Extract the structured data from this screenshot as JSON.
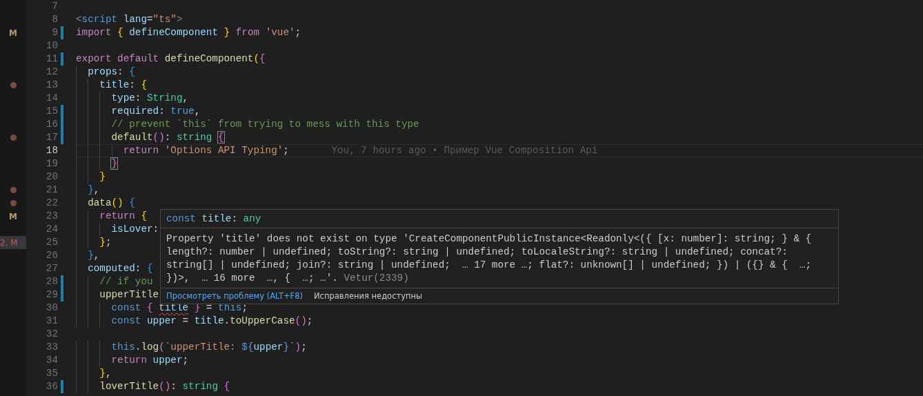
{
  "lines": [
    {
      "number": "7",
      "changed": false,
      "current": false
    },
    {
      "number": "8",
      "changed": false,
      "current": false,
      "tokens": [
        {
          "text": "<",
          "kind": "tagp"
        },
        {
          "text": "script",
          "kind": "tag"
        },
        {
          "text": " lang",
          "kind": "attr"
        },
        {
          "text": "=",
          "kind": "punct"
        },
        {
          "text": "\"ts\"",
          "kind": "str"
        },
        {
          "text": ">",
          "kind": "tagp"
        }
      ]
    },
    {
      "number": "9",
      "changed": true,
      "current": false,
      "mark": {
        "kind": "letter",
        "text": "M",
        "selected": false
      },
      "tokens": [
        {
          "text": "import",
          "kind": "kw"
        },
        {
          "text": " {",
          "kind": "b1"
        },
        {
          "text": " defineComponent",
          "kind": "var"
        },
        {
          "text": " }",
          "kind": "b1"
        },
        {
          "text": " from",
          "kind": "kw"
        },
        {
          "text": " 'vue'",
          "kind": "str"
        },
        {
          "text": ";",
          "kind": "punct"
        }
      ]
    },
    {
      "number": "10",
      "changed": false,
      "current": false
    },
    {
      "number": "11",
      "changed": true,
      "current": false,
      "tokens": [
        {
          "text": "export",
          "kind": "kw"
        },
        {
          "text": " default",
          "kind": "kw"
        },
        {
          "text": " defineComponent",
          "kind": "fn"
        },
        {
          "text": "(",
          "kind": "b1"
        },
        {
          "text": "{",
          "kind": "b2"
        }
      ]
    },
    {
      "number": "12",
      "changed": false,
      "current": false,
      "tokens": [
        {
          "text": "  props",
          "kind": "var"
        },
        {
          "text": ":",
          "kind": "punct"
        },
        {
          "text": " {",
          "kind": "b3"
        }
      ]
    },
    {
      "number": "13",
      "changed": false,
      "current": false,
      "mark": {
        "kind": "dot",
        "selected": false
      },
      "tokens": [
        {
          "text": "    title",
          "kind": "var"
        },
        {
          "text": ":",
          "kind": "punct"
        },
        {
          "text": " {",
          "kind": "b1"
        }
      ]
    },
    {
      "number": "14",
      "changed": false,
      "current": false,
      "tokens": [
        {
          "text": "      type",
          "kind": "var"
        },
        {
          "text": ":",
          "kind": "punct"
        },
        {
          "text": " String",
          "kind": "type"
        },
        {
          "text": ",",
          "kind": "punct"
        }
      ]
    },
    {
      "number": "15",
      "changed": true,
      "current": false,
      "tokens": [
        {
          "text": "      required",
          "kind": "var"
        },
        {
          "text": ":",
          "kind": "punct"
        },
        {
          "text": " true",
          "kind": "const"
        },
        {
          "text": ",",
          "kind": "punct"
        }
      ]
    },
    {
      "number": "16",
      "changed": true,
      "current": false,
      "tokens": [
        {
          "text": "      // prevent `this` from trying to mess with this type",
          "kind": "comment"
        }
      ]
    },
    {
      "number": "17",
      "changed": true,
      "current": false,
      "mark": {
        "kind": "dot",
        "selected": false
      },
      "tokens": [
        {
          "text": "      default",
          "kind": "fn"
        },
        {
          "text": "(",
          "kind": "b2"
        },
        {
          "text": ")",
          "kind": "b2"
        },
        {
          "text": ":",
          "kind": "punct"
        },
        {
          "text": " string",
          "kind": "type"
        },
        {
          "text": " {",
          "kind": "b2m"
        }
      ]
    },
    {
      "number": "18",
      "changed": false,
      "current": true,
      "blame": "You, 7 hours ago • Пример Vue Composition Api",
      "tokens": [
        {
          "text": "        return",
          "kind": "kw"
        },
        {
          "text": " 'Options API Typing'",
          "kind": "str"
        },
        {
          "text": ";",
          "kind": "punct"
        }
      ]
    },
    {
      "number": "19",
      "changed": false,
      "current": false,
      "tokens": [
        {
          "text": "      }",
          "kind": "b2m"
        }
      ]
    },
    {
      "number": "20",
      "changed": false,
      "current": false,
      "tokens": [
        {
          "text": "    }",
          "kind": "b1"
        }
      ]
    },
    {
      "number": "21",
      "changed": false,
      "current": false,
      "mark": {
        "kind": "dot",
        "selected": false
      },
      "tokens": [
        {
          "text": "  }",
          "kind": "b3"
        },
        {
          "text": ",",
          "kind": "punct"
        }
      ]
    },
    {
      "number": "22",
      "changed": false,
      "current": false,
      "mark": {
        "kind": "dot",
        "selected": false
      },
      "tokens": [
        {
          "text": "  data",
          "kind": "fn"
        },
        {
          "text": "(",
          "kind": "b1"
        },
        {
          "text": ")",
          "kind": "b1"
        },
        {
          "text": " {",
          "kind": "b3"
        }
      ]
    },
    {
      "number": "23",
      "changed": false,
      "current": false,
      "mark": {
        "kind": "letter",
        "text": "M",
        "selected": false
      },
      "tokens": [
        {
          "text": "    return",
          "kind": "kw"
        },
        {
          "text": " {",
          "kind": "b1"
        }
      ]
    },
    {
      "number": "24",
      "changed": false,
      "current": false,
      "tokens": [
        {
          "text": "      isLover",
          "kind": "var"
        },
        {
          "text": ":",
          "kind": "punct"
        }
      ]
    },
    {
      "number": "25",
      "changed": false,
      "current": false,
      "mark": {
        "kind": "letter",
        "text": "2, M",
        "selected": true
      },
      "tokens": [
        {
          "text": "    }",
          "kind": "b1"
        },
        {
          "text": ";",
          "kind": "punct"
        }
      ]
    },
    {
      "number": "26",
      "changed": false,
      "current": false,
      "tokens": [
        {
          "text": "  }",
          "kind": "b3"
        },
        {
          "text": ",",
          "kind": "punct"
        }
      ]
    },
    {
      "number": "27",
      "changed": false,
      "current": false,
      "tokens": [
        {
          "text": "  computed",
          "kind": "var"
        },
        {
          "text": ":",
          "kind": "punct"
        },
        {
          "text": " {",
          "kind": "b3"
        }
      ]
    },
    {
      "number": "28",
      "changed": true,
      "current": false,
      "tokens": [
        {
          "text": "    // if you",
          "kind": "comment"
        }
      ]
    },
    {
      "number": "29",
      "changed": true,
      "current": false,
      "tokens": [
        {
          "text": "    upperTitle",
          "kind": "fn"
        }
      ]
    },
    {
      "number": "30",
      "changed": false,
      "current": false,
      "tokens": [
        {
          "text": "      const",
          "kind": "const"
        },
        {
          "text": " {",
          "kind": "b2"
        },
        {
          "text": " title",
          "kind": "varerr"
        },
        {
          "text": " }",
          "kind": "b2"
        },
        {
          "text": " =",
          "kind": "punct"
        },
        {
          "text": " this",
          "kind": "const"
        },
        {
          "text": ";",
          "kind": "punct"
        }
      ]
    },
    {
      "number": "31",
      "changed": false,
      "current": false,
      "tokens": [
        {
          "text": "      const",
          "kind": "const"
        },
        {
          "text": " upper",
          "kind": "var"
        },
        {
          "text": " =",
          "kind": "punct"
        },
        {
          "text": " title",
          "kind": "var"
        },
        {
          "text": ".",
          "kind": "punct"
        },
        {
          "text": "toUpperCase",
          "kind": "fn"
        },
        {
          "text": "(",
          "kind": "b2"
        },
        {
          "text": ")",
          "kind": "b2"
        },
        {
          "text": ";",
          "kind": "punct"
        }
      ]
    },
    {
      "number": "32",
      "changed": false,
      "current": false
    },
    {
      "number": "33",
      "changed": false,
      "current": false,
      "tokens": [
        {
          "text": "      this",
          "kind": "const"
        },
        {
          "text": ".",
          "kind": "punct"
        },
        {
          "text": "log",
          "kind": "fn"
        },
        {
          "text": "(",
          "kind": "b2"
        },
        {
          "text": "`upperTitle: ",
          "kind": "str"
        },
        {
          "text": "${",
          "kind": "const"
        },
        {
          "text": "upper",
          "kind": "var"
        },
        {
          "text": "}",
          "kind": "const"
        },
        {
          "text": "`",
          "kind": "str"
        },
        {
          "text": ")",
          "kind": "b2"
        },
        {
          "text": ";",
          "kind": "punct"
        }
      ]
    },
    {
      "number": "34",
      "changed": false,
      "current": false,
      "tokens": [
        {
          "text": "      return",
          "kind": "kw"
        },
        {
          "text": " upper",
          "kind": "var"
        },
        {
          "text": ";",
          "kind": "punct"
        }
      ]
    },
    {
      "number": "35",
      "changed": false,
      "current": false,
      "tokens": [
        {
          "text": "    }",
          "kind": "b1"
        },
        {
          "text": ",",
          "kind": "punct"
        }
      ]
    },
    {
      "number": "36",
      "changed": true,
      "current": false,
      "tokens": [
        {
          "text": "    loverTitle",
          "kind": "fn"
        },
        {
          "text": "(",
          "kind": "b2"
        },
        {
          "text": ")",
          "kind": "b2"
        },
        {
          "text": ":",
          "kind": "punct"
        },
        {
          "text": " string",
          "kind": "type"
        },
        {
          "text": " {",
          "kind": "b2"
        }
      ]
    }
  ],
  "hover": {
    "signature": [
      {
        "text": "const",
        "kind": "const"
      },
      {
        "text": " title",
        "kind": "var"
      },
      {
        "text": ":",
        "kind": "punct"
      },
      {
        "text": " any",
        "kind": "type"
      }
    ],
    "message": "Property 'title' does not exist on type 'CreateComponentPublicInstance<Readonly<({ [x: number]: string; } & { length?: number | undefined; toString?: string | undefined; toLocaleString?: string | undefined; concat?: string[] | undefined; join?: string | undefined;  … 17 more …; flat?: unknown[] | undefined; }) | ({} & {  …; })>,  … 16 more  …, {  …; …'.",
    "source": "Vetur(2339)",
    "actions": [
      {
        "text": "Просмотреть проблему (ALT+F8)",
        "kind": "link"
      },
      {
        "text": "Исправления недоступны",
        "kind": "disabled"
      }
    ]
  }
}
